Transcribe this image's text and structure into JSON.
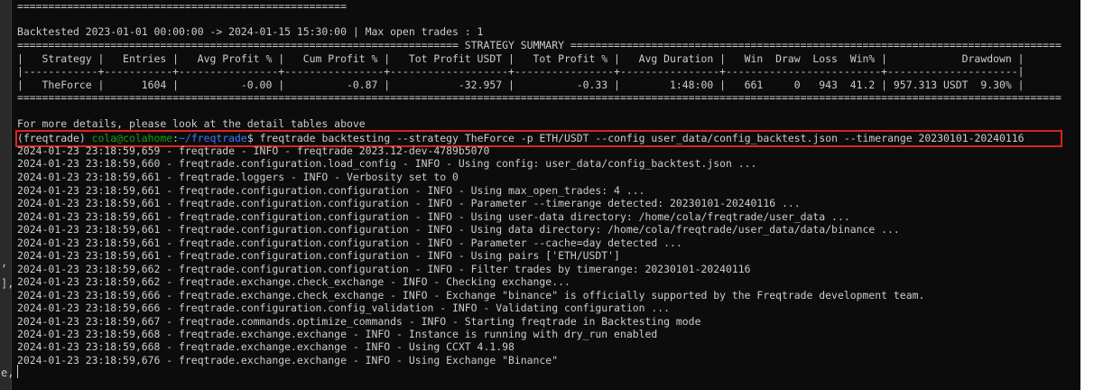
{
  "terminal": {
    "lines": [
      "=====================================================",
      "",
      "Backtested 2023-01-01 00:00:00 -> 2024-01-15 15:30:00 | Max open trades : 1",
      "======================================================================= STRATEGY SUMMARY ===============================================================================",
      "|   Strategy |   Entries |   Avg Profit % |   Cum Profit % |   Tot Profit USDT |   Tot Profit % |   Avg Duration |   Win  Draw  Loss  Win% |            Drawdown |",
      "|------------+-----------+----------------+----------------+-------------------+----------------+----------------+-------------------------+---------------------|",
      "|   TheForce |      1604 |          -0.00 |          -0.87 |           -32.957 |          -0.33 |        1:48:00 |   661     0   943  41.2 | 957.313 USDT  9.30% |",
      "========================================================================================================================================================================",
      "",
      "For more details, please look at the detail tables above"
    ],
    "prompt": {
      "env": "(freqtrade) ",
      "user_host": "cola@colahome",
      "separator": ":",
      "path": "~/freqtrade",
      "symbol": "$ ",
      "command": "freqtrade backtesting --strategy TheForce -p ETH/USDT --config user_data/config_backtest.json --timerange 20230101-20240116"
    },
    "log_lines": [
      "2024-01-23 23:18:59,659 - freqtrade - INFO - freqtrade 2023.12-dev-4789b5070",
      "2024-01-23 23:18:59,660 - freqtrade.configuration.load_config - INFO - Using config: user_data/config_backtest.json ...",
      "2024-01-23 23:18:59,661 - freqtrade.loggers - INFO - Verbosity set to 0",
      "2024-01-23 23:18:59,661 - freqtrade.configuration.configuration - INFO - Using max_open_trades: 4 ...",
      "2024-01-23 23:18:59,661 - freqtrade.configuration.configuration - INFO - Parameter --timerange detected: 20230101-20240116 ...",
      "2024-01-23 23:18:59,661 - freqtrade.configuration.configuration - INFO - Using user-data directory: /home/cola/freqtrade/user_data ...",
      "2024-01-23 23:18:59,661 - freqtrade.configuration.configuration - INFO - Using data directory: /home/cola/freqtrade/user_data/data/binance ...",
      "2024-01-23 23:18:59,661 - freqtrade.configuration.configuration - INFO - Parameter --cache=day detected ...",
      "2024-01-23 23:18:59,661 - freqtrade.configuration.configuration - INFO - Using pairs ['ETH/USDT']",
      "2024-01-23 23:18:59,662 - freqtrade.configuration.configuration - INFO - Filter trades by timerange: 20230101-20240116",
      "2024-01-23 23:18:59,662 - freqtrade.exchange.check_exchange - INFO - Checking exchange...",
      "2024-01-23 23:18:59,666 - freqtrade.exchange.check_exchange - INFO - Exchange \"binance\" is officially supported by the Freqtrade development team.",
      "2024-01-23 23:18:59,666 - freqtrade.configuration.config_validation - INFO - Validating configuration ...",
      "2024-01-23 23:18:59,667 - freqtrade.commands.optimize_commands - INFO - Starting freqtrade in Backtesting mode",
      "2024-01-23 23:18:59,668 - freqtrade.exchange.exchange - INFO - Instance is running with dry_run enabled",
      "2024-01-23 23:18:59,668 - freqtrade.exchange.exchange - INFO - Using CCXT 4.1.98",
      "2024-01-23 23:18:59,676 - freqtrade.exchange.exchange - INFO - Using Exchange \"Binance\""
    ]
  },
  "gutter": {
    "marks": [
      ",",
      "],",
      "e,"
    ]
  },
  "colors": {
    "background": "#0c0c0c",
    "text": "#cccccc",
    "user_host": "#13a10e",
    "path": "#3b78ff",
    "highlight_border": "#e0211b"
  }
}
